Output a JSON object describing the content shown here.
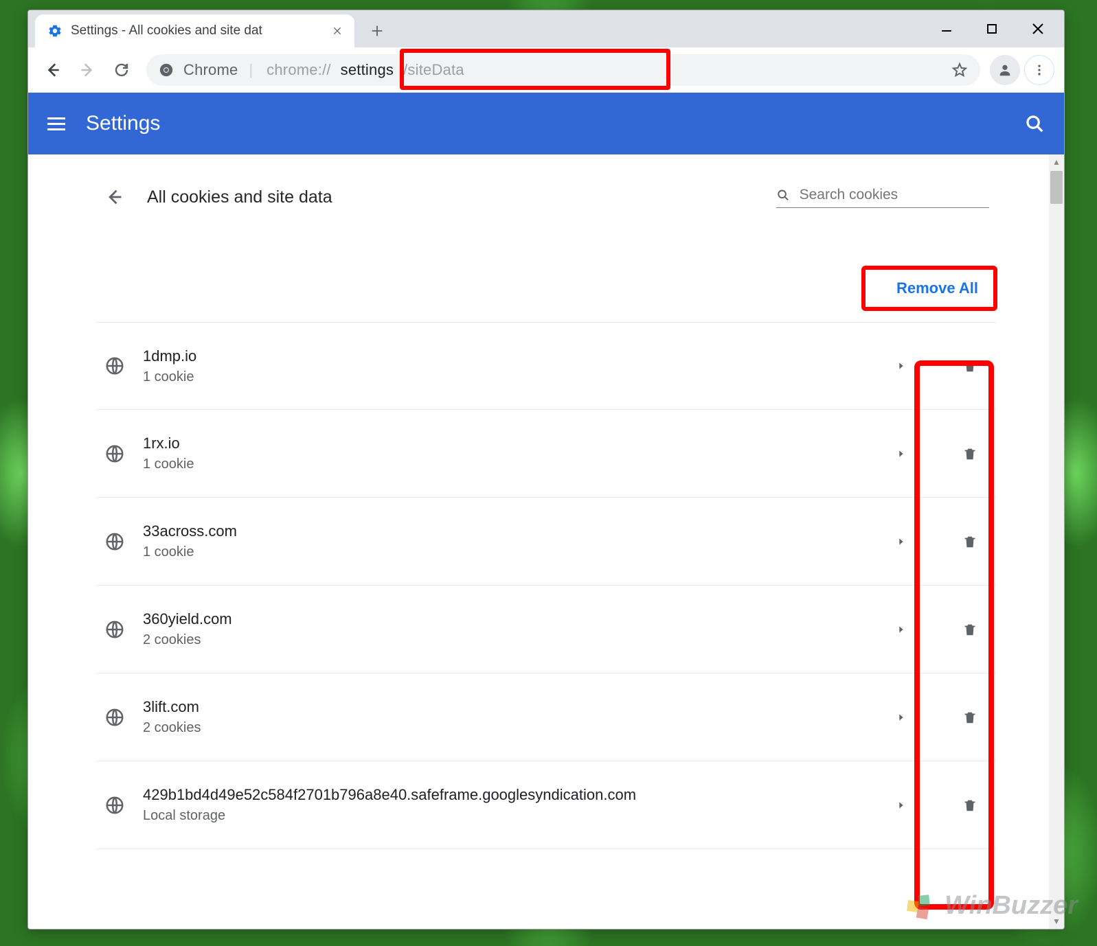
{
  "window": {
    "tab_title": "Settings - All cookies and site dat",
    "new_tab_tooltip": "New tab"
  },
  "toolbar": {
    "chrome_chip": "Chrome",
    "url": "chrome://settings/siteData",
    "url_prefix": "chrome://",
    "url_bold": "settings",
    "url_suffix": "/siteData"
  },
  "app_bar": {
    "title": "Settings"
  },
  "panel": {
    "title": "All cookies and site data",
    "search_placeholder": "Search cookies",
    "remove_all_label": "Remove All"
  },
  "sites": [
    {
      "domain": "1dmp.io",
      "sub": "1 cookie"
    },
    {
      "domain": "1rx.io",
      "sub": "1 cookie"
    },
    {
      "domain": "33across.com",
      "sub": "1 cookie"
    },
    {
      "domain": "360yield.com",
      "sub": "2 cookies"
    },
    {
      "domain": "3lift.com",
      "sub": "2 cookies"
    },
    {
      "domain": "429b1bd4d49e52c584f2701b796a8e40.safeframe.googlesyndication.com",
      "sub": "Local storage"
    }
  ],
  "watermark": "WinBuzzer"
}
